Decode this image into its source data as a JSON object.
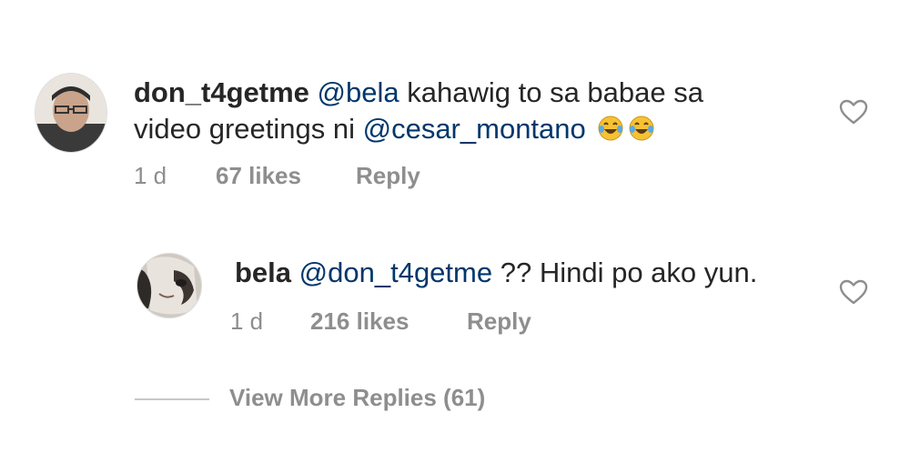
{
  "comments": [
    {
      "username": "don_t4getme",
      "mention1": "@bela",
      "text1": " kahawig to sa babae sa",
      "text2": "video greetings ni ",
      "mention2": "@cesar_montano",
      "emoji": [
        "laughing-tears-emoji",
        "laughing-tears-emoji"
      ],
      "time": "1 d",
      "likes": "67 likes",
      "reply": "Reply"
    },
    {
      "username": "bela",
      "mention1": "@don_t4getme",
      "text1": " ?? Hindi po ako yun.",
      "time": "1 d",
      "likes": "216 likes",
      "reply": "Reply"
    }
  ],
  "view_more": "View More Replies (61)",
  "colors": {
    "text": "#262626",
    "mention": "#00376b",
    "meta": "#8e8e8e",
    "divider": "#c7c7c7"
  }
}
